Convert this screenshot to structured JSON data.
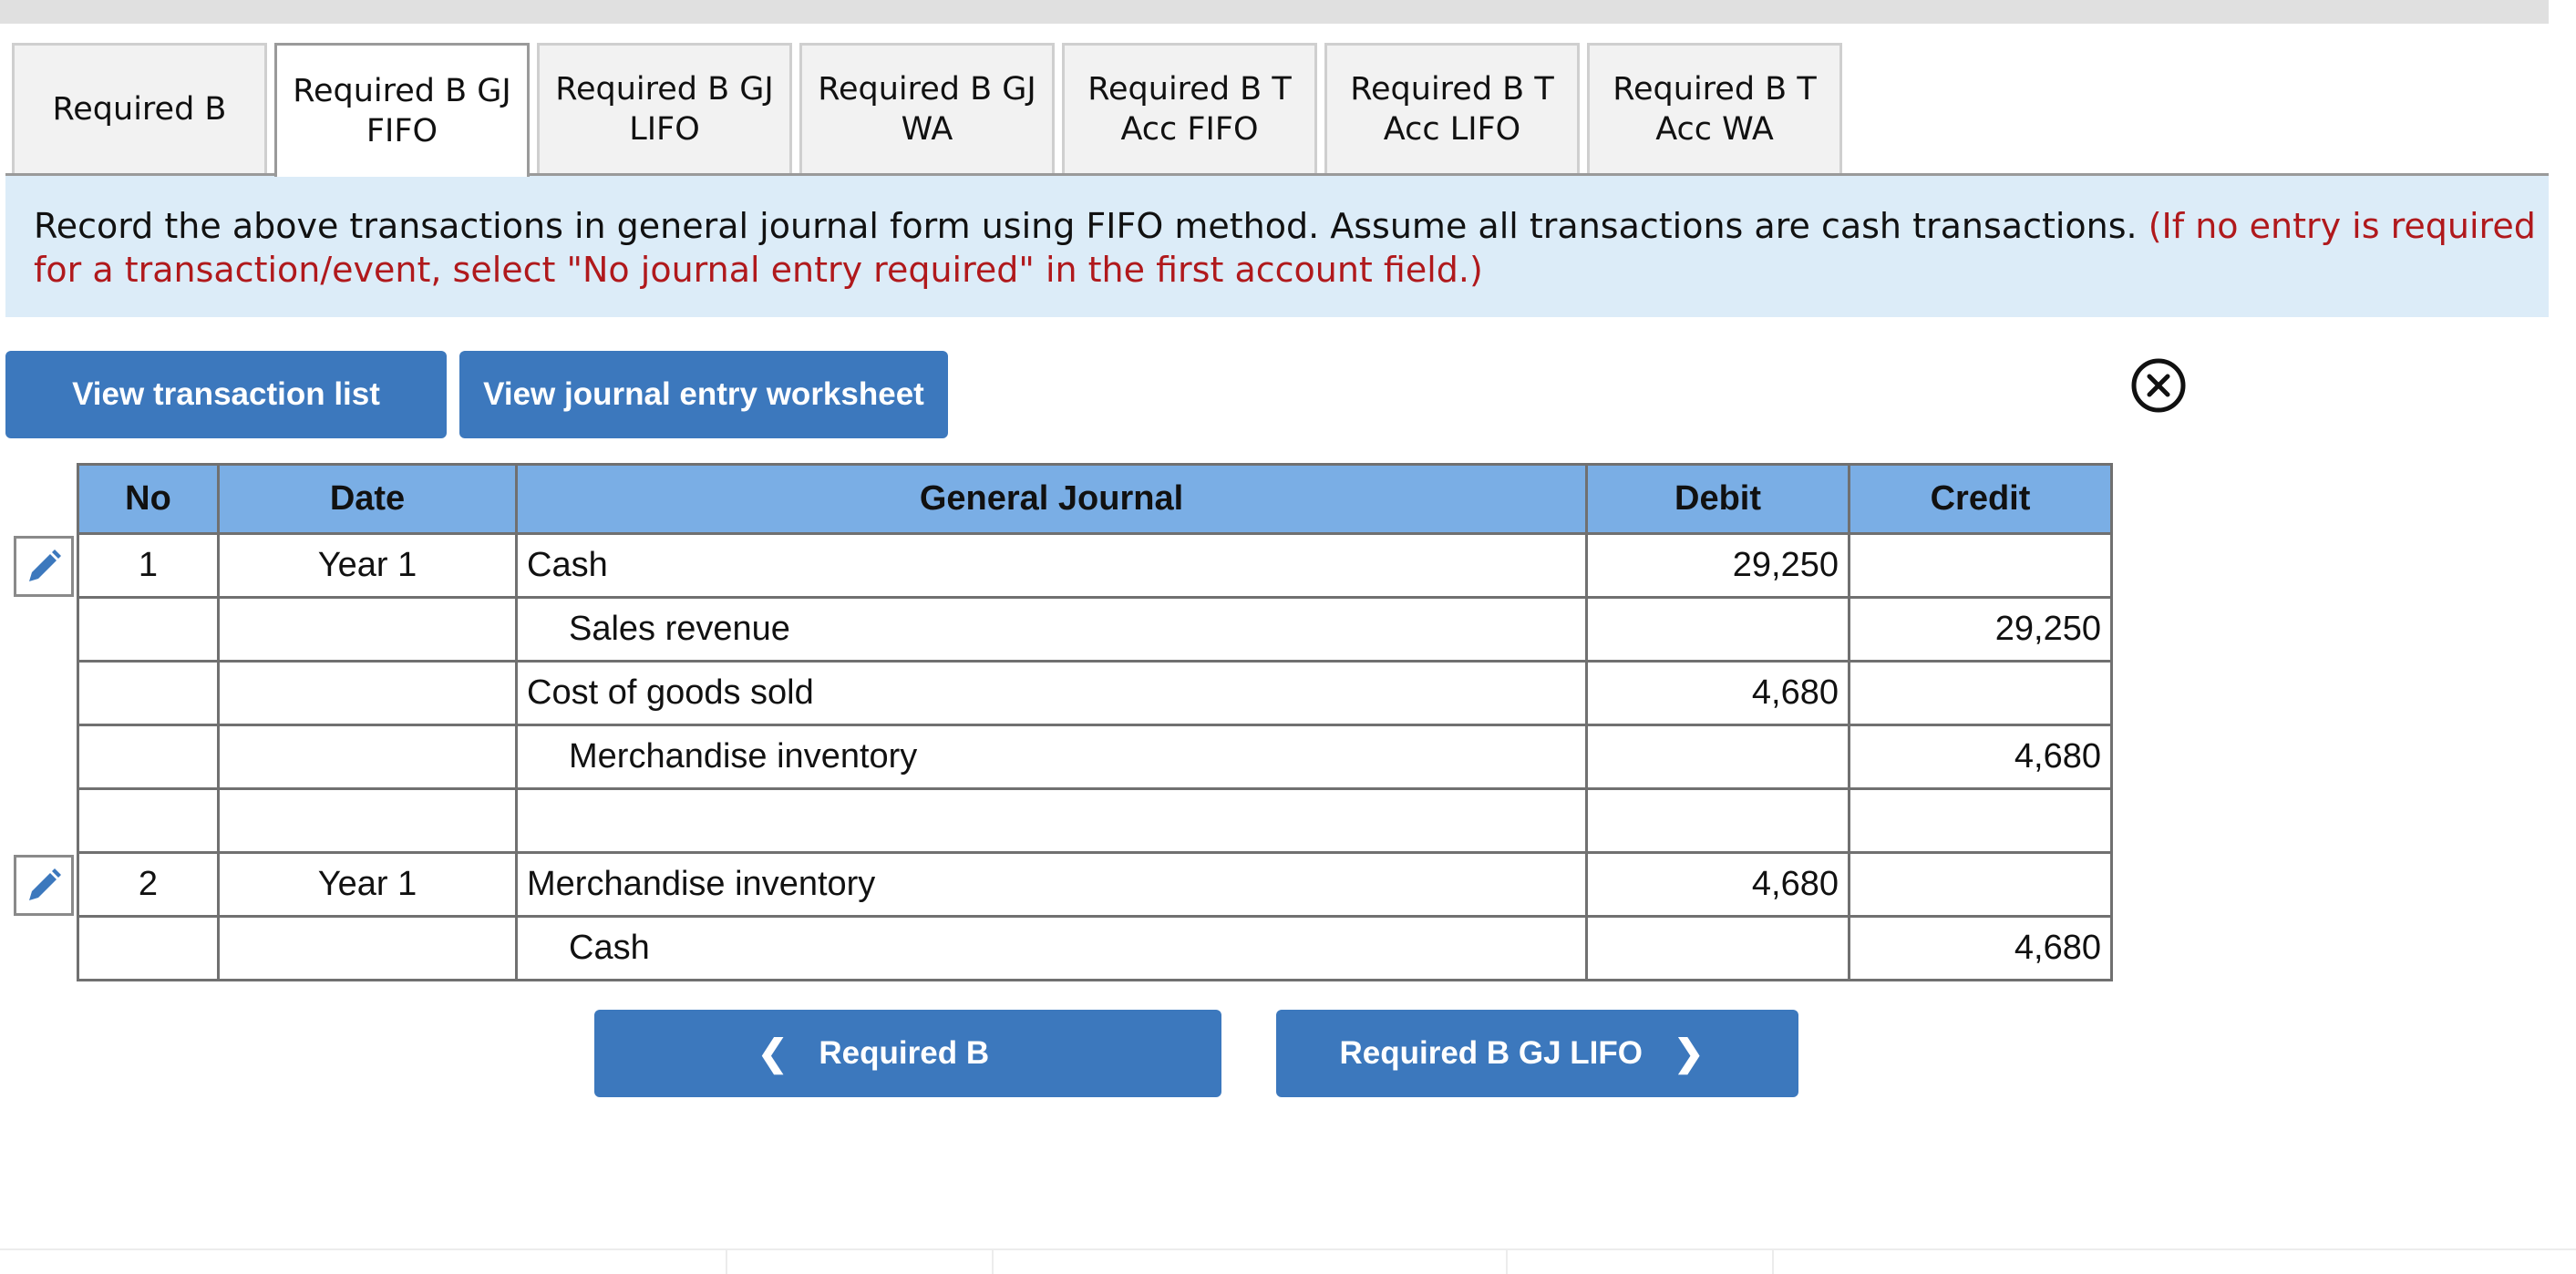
{
  "tabs": [
    {
      "label": "Required B",
      "active": false
    },
    {
      "label": "Required B GJ\nFIFO",
      "active": true
    },
    {
      "label": "Required B GJ\nLIFO",
      "active": false
    },
    {
      "label": "Required B GJ\nWA",
      "active": false
    },
    {
      "label": "Required B T\nAcc FIFO",
      "active": false
    },
    {
      "label": "Required B T\nAcc LIFO",
      "active": false
    },
    {
      "label": "Required B T\nAcc WA",
      "active": false
    }
  ],
  "instruction": {
    "text": "Record the above transactions in general journal form using FIFO method. Assume all transactions are cash transactions. ",
    "note": "(If no entry is required for a transaction/event, select \"No journal entry required\" in the first account field.)"
  },
  "buttons": {
    "view_transactions": "View transaction list",
    "view_worksheet": "View journal entry worksheet"
  },
  "icons": {
    "close": "close-circle-icon",
    "edit": "pencil-icon"
  },
  "colors": {
    "accent": "#3c78bd",
    "header": "#7aaee5",
    "instruction_bg": "#dcecf8",
    "note": "#b0191c"
  },
  "journal": {
    "headers": {
      "no": "No",
      "date": "Date",
      "account": "General Journal",
      "debit": "Debit",
      "credit": "Credit"
    },
    "rows": [
      {
        "no": "1",
        "date": "Year 1",
        "account": "Cash",
        "indent": false,
        "debit": "29,250",
        "credit": ""
      },
      {
        "no": "",
        "date": "",
        "account": "Sales revenue",
        "indent": true,
        "debit": "",
        "credit": "29,250"
      },
      {
        "no": "",
        "date": "",
        "account": "Cost of goods sold",
        "indent": false,
        "debit": "4,680",
        "credit": ""
      },
      {
        "no": "",
        "date": "",
        "account": "Merchandise inventory",
        "indent": true,
        "debit": "",
        "credit": "4,680"
      },
      {
        "no": "",
        "date": "",
        "account": "",
        "indent": false,
        "debit": "",
        "credit": ""
      },
      {
        "no": "2",
        "date": "Year 1",
        "account": "Merchandise inventory",
        "indent": false,
        "debit": "4,680",
        "credit": ""
      },
      {
        "no": "",
        "date": "",
        "account": "Cash",
        "indent": true,
        "debit": "",
        "credit": "4,680"
      }
    ]
  },
  "nav": {
    "prev_label": "Required B",
    "next_label": "Required B GJ LIFO"
  }
}
